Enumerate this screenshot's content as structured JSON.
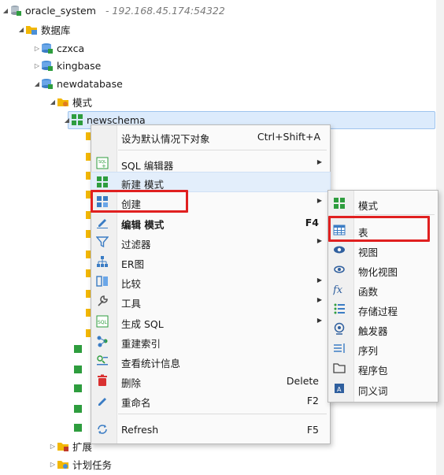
{
  "tree": {
    "connection": {
      "name": "oracle_system",
      "address": "- 192.168.45.174:54322"
    },
    "databases_folder": "数据库",
    "databases": [
      "czxca",
      "kingbase",
      "newdatabase"
    ],
    "schemas_folder": "模式",
    "schema": "newschema",
    "extension_folder": "扩展",
    "scheduled_tasks_folder": "计划任务"
  },
  "context_menu": {
    "items": [
      {
        "label": "设为默认情况下对象",
        "shortcut": "Ctrl+Shift+A"
      },
      {
        "label": "SQL 编辑器",
        "submenu": true
      },
      {
        "label": "新建 模式"
      },
      {
        "label": "创建",
        "submenu": true
      },
      {
        "label": "编辑 模式",
        "shortcut": "F4",
        "bold": true
      },
      {
        "label": "过滤器",
        "submenu": true
      },
      {
        "label": "ER图"
      },
      {
        "label": "比较",
        "submenu": true
      },
      {
        "label": "工具",
        "submenu": true
      },
      {
        "label": "生成 SQL",
        "submenu": true
      },
      {
        "label": "重建索引"
      },
      {
        "label": "查看统计信息"
      },
      {
        "label": "删除",
        "shortcut": "Delete"
      },
      {
        "label": "重命名",
        "shortcut": "F2"
      },
      {
        "label": "Refresh",
        "shortcut": "F5"
      }
    ]
  },
  "create_submenu": {
    "items": [
      "模式",
      "表",
      "视图",
      "物化视图",
      "函数",
      "存储过程",
      "触发器",
      "序列",
      "程序包",
      "同义词"
    ]
  },
  "colors": {
    "highlight": "#e02020",
    "selection": "#dcebfc",
    "accent_green": "#2e9d3e",
    "folder_yellow": "#f2b705"
  }
}
